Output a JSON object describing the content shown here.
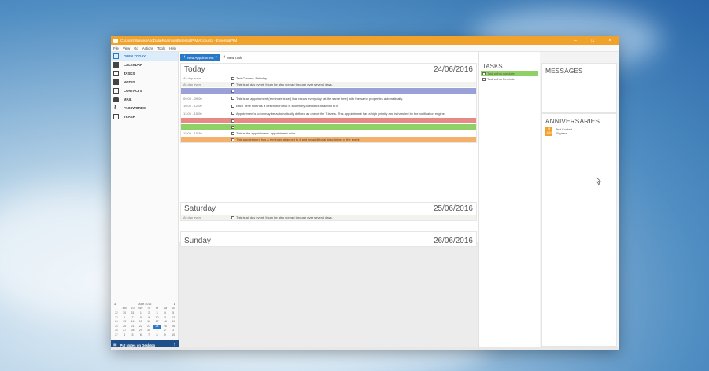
{
  "window": {
    "title": "C:\\Users\\Wayne\\AppData\\Roaming\\EssentialPIM\\Accounts - EssentialPIM",
    "controls": [
      "–",
      "□",
      "×"
    ]
  },
  "menubar": [
    "File",
    "View",
    "Go",
    "Actions",
    "Tools",
    "Help"
  ],
  "sidebar": {
    "items": [
      {
        "label": "OPEN TODAY",
        "icon": "calendar-today-icon"
      },
      {
        "label": "CALENDAR",
        "icon": "calendar-icon"
      },
      {
        "label": "TASKS",
        "icon": "tasks-icon"
      },
      {
        "label": "NOTES",
        "icon": "notes-icon"
      },
      {
        "label": "CONTACTS",
        "icon": "contacts-icon"
      },
      {
        "label": "MAIL",
        "icon": "mail-icon"
      },
      {
        "label": "PASSWORDS",
        "icon": "key-icon"
      },
      {
        "label": "TRASH",
        "icon": "trash-icon"
      }
    ],
    "mini_calendar": {
      "month": "June 2016",
      "weekdays": [
        "",
        "Mo",
        "Tu",
        "We",
        "Th",
        "Fr",
        "Sa",
        "Su"
      ],
      "rows": [
        [
          "22",
          "30",
          "31",
          "1",
          "2",
          "3",
          "4",
          "5"
        ],
        [
          "23",
          "6",
          "7",
          "8",
          "9",
          "10",
          "11",
          "12"
        ],
        [
          "24",
          "13",
          "14",
          "15",
          "16",
          "17",
          "18",
          "19"
        ],
        [
          "25",
          "20",
          "21",
          "22",
          "23",
          "24",
          "25",
          "26"
        ],
        [
          "26",
          "27",
          "28",
          "29",
          "30",
          "1",
          "2",
          "3"
        ],
        [
          "27",
          "4",
          "5",
          "6",
          "7",
          "8",
          "9",
          "10"
        ]
      ],
      "selected": "24"
    },
    "notes_button": "Put Notes on Desktop"
  },
  "toolbar": {
    "new_appointment": "New Appointment",
    "new_task": "New Task"
  },
  "today": {
    "title": "Today",
    "date": "24/06/2016",
    "events": [
      {
        "time": "All day event",
        "text": "Test Contact: Birthday",
        "color": "#ffffff"
      },
      {
        "time": "All day event",
        "text": "This is all day event. It can be also spread through over several days.",
        "color": "#f2f2ef"
      },
      {
        "time": "",
        "text": "",
        "color": "#9aa0d8"
      },
      {
        "time": "09:00 - 09:00",
        "text": "This is an appointment (reminder is set) that recurs every day (at the same time) with the same properties automatically.",
        "color": "#ffffff"
      },
      {
        "time": "10:00 - 12:00",
        "text": "Each Time slot has a description that is shown by checkbox attached to it.",
        "color": "#ffffff"
      },
      {
        "time": "13:00 - 15:00",
        "text": "Appointment's color may be automatically defined as one of the 7 levels. This appointment has a high priority and is handled by the notification engine.",
        "color": "#ffffff"
      },
      {
        "time": "",
        "text": "",
        "color": "#e78a86"
      },
      {
        "time": "",
        "text": "",
        "color": "#8fd166"
      },
      {
        "time": "15:00 - 15:30",
        "text": "This is the appointment: appointment color.",
        "color": "#ffffff"
      },
      {
        "time": "",
        "text": "This appointment has a reminder attached to it and an additional description of the event.",
        "color": "#f3b16b"
      }
    ]
  },
  "saturday": {
    "title": "Saturday",
    "date": "25/06/2016",
    "events": [
      {
        "time": "All day event",
        "text": "This is all day event. It can be also spread through over several days.",
        "color": "#f2f2ef"
      }
    ]
  },
  "sunday": {
    "title": "Sunday",
    "date": "26/06/2016"
  },
  "tasks": {
    "title": "TASKS",
    "items": [
      {
        "text": "Task with a due date",
        "color": "#8fd166"
      },
      {
        "text": "Task with a Reminder",
        "color": "#ffffff"
      }
    ]
  },
  "messages": {
    "title": "MESSAGES"
  },
  "anniversaries": {
    "title": "ANNIVERSARIES",
    "items": [
      {
        "badge_top": "24",
        "badge_bottom": "JUN",
        "name": "Test Contact",
        "detail": "20 years"
      }
    ]
  }
}
